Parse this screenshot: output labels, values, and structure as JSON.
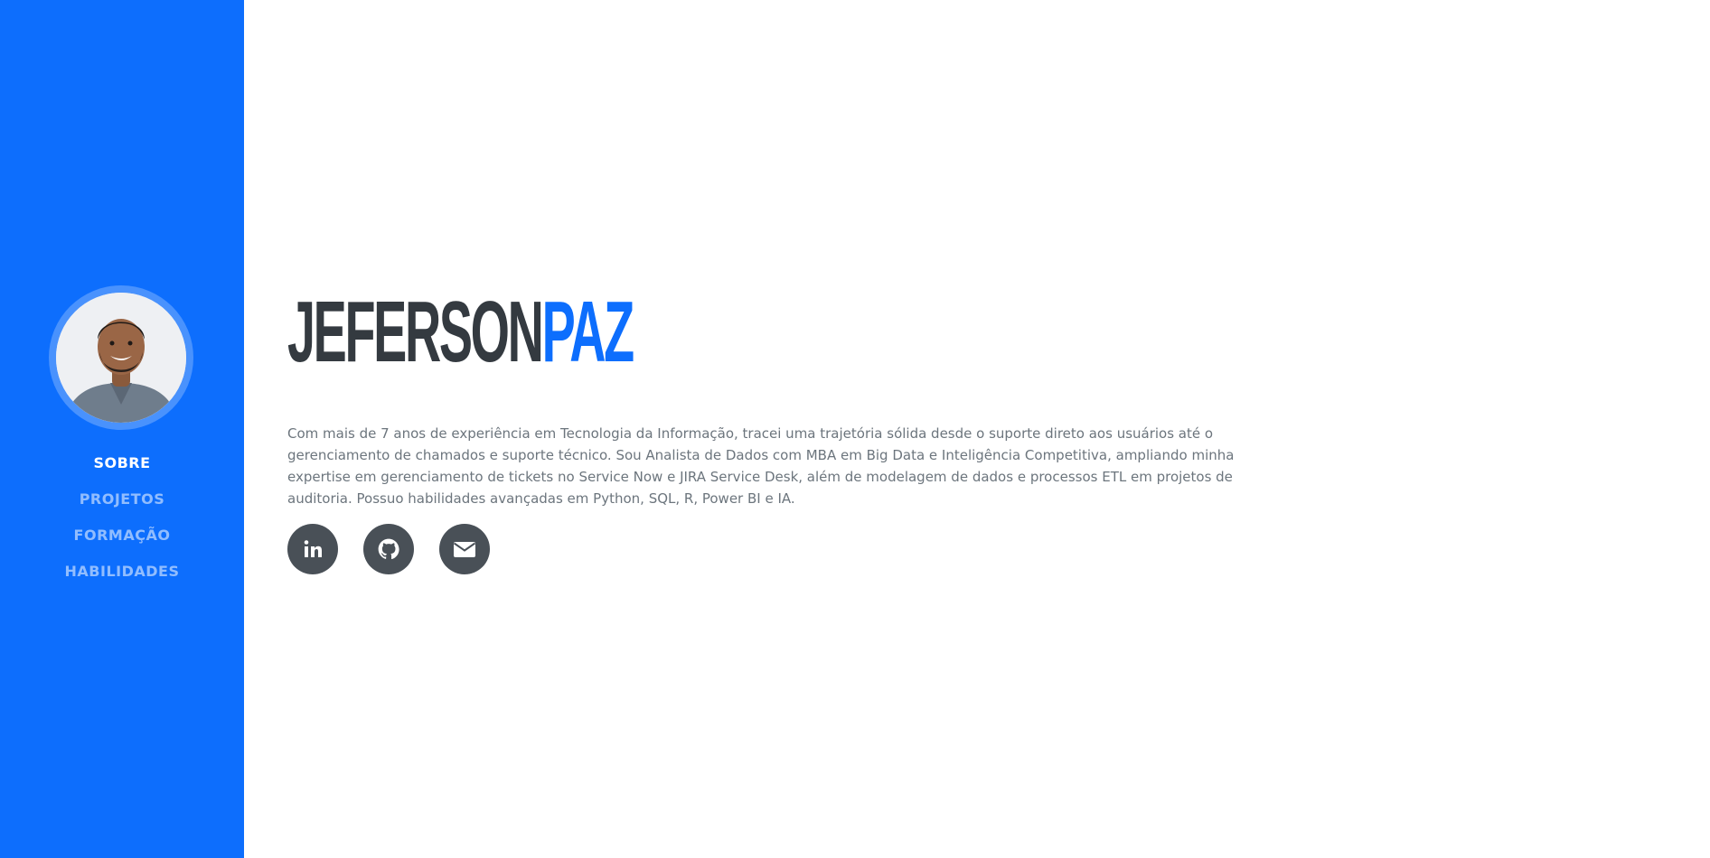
{
  "sidebar": {
    "avatar_alt": "Jeferson Paz",
    "nav": [
      {
        "label": "SOBRE",
        "active": true
      },
      {
        "label": "PROJETOS",
        "active": false
      },
      {
        "label": "FORMAÇÃO",
        "active": false
      },
      {
        "label": "HABILIDADES",
        "active": false
      }
    ]
  },
  "main": {
    "first_name": "JEFERSON",
    "last_name": "PAZ",
    "bio": "Com mais de 7 anos de experiência em Tecnologia da Informação, tracei uma trajetória sólida desde o suporte direto aos usuários até o gerenciamento de chamados e suporte técnico. Sou Analista de Dados com MBA em Big Data e Inteligência Competitiva, ampliando minha expertise em gerenciamento de tickets no Service Now e JIRA Service Desk, além de modelagem de dados e processos ETL em projetos de auditoria. Possuo habilidades avançadas em Python, SQL, R, Power BI e IA.",
    "social": [
      {
        "name": "linkedin-icon"
      },
      {
        "name": "github-icon"
      },
      {
        "name": "envelope-icon"
      }
    ]
  },
  "colors": {
    "primary": "#0d6efd",
    "heading": "#343a40",
    "text": "#6c757d",
    "social_bg": "#495057"
  }
}
